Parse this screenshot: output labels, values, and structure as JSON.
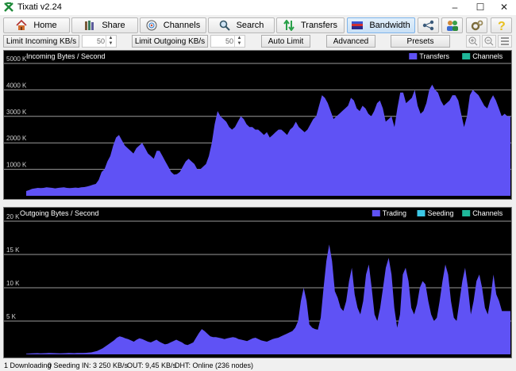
{
  "window": {
    "title": "Tixati v2.24",
    "controls": [
      "–",
      "☐",
      "✕"
    ]
  },
  "toolbar": {
    "buttons": [
      {
        "label": "Home",
        "icon": "home-icon"
      },
      {
        "label": "Share",
        "icon": "share-icon"
      },
      {
        "label": "Channels",
        "icon": "channels-icon"
      },
      {
        "label": "Search",
        "icon": "search-icon"
      },
      {
        "label": "Transfers",
        "icon": "transfers-icon"
      },
      {
        "label": "Bandwidth",
        "icon": "bandwidth-icon",
        "active": true
      }
    ],
    "icon_buttons": [
      "network-icon",
      "users-icon",
      "settings-icon",
      "help-icon"
    ]
  },
  "controls": {
    "limit_in_label": "Limit Incoming KB/s",
    "limit_in_value": "50",
    "limit_out_label": "Limit Outgoing KB/s",
    "limit_out_value": "50",
    "auto_limit_label": "Auto Limit",
    "advanced_label": "Advanced",
    "presets_label": "Presets"
  },
  "colors": {
    "transfers": "#5f52f5",
    "trading": "#5f52f5",
    "seeding": "#3cc8e6",
    "channels": "#1fb89a",
    "gridline": "#9a9a9a"
  },
  "chart_data": [
    {
      "type": "area",
      "title": "Incoming Bytes / Second",
      "ylim": [
        0,
        5000
      ],
      "y_ticks": [
        "1000 K",
        "2000 K",
        "3000 K",
        "4000 K",
        "5000 K"
      ],
      "grid": true,
      "legend": [
        {
          "name": "Transfers"
        },
        {
          "name": "Channels"
        }
      ],
      "series": [
        {
          "name": "Transfers",
          "values": [
            180,
            220,
            260,
            280,
            300,
            290,
            300,
            320,
            310,
            300,
            280,
            300,
            310,
            320,
            300,
            290,
            300,
            310,
            300,
            320,
            330,
            350,
            380,
            420,
            450,
            600,
            900,
            1000,
            1300,
            1500,
            1900,
            2200,
            2300,
            2100,
            1900,
            1800,
            1700,
            1600,
            1800,
            1900,
            2000,
            1800,
            1600,
            1500,
            1400,
            1700,
            1700,
            1500,
            1300,
            1100,
            900,
            800,
            820,
            900,
            1100,
            1300,
            1400,
            1300,
            1200,
            1000,
            1000,
            1100,
            1200,
            1500,
            2000,
            2700,
            3200,
            3000,
            2900,
            2800,
            2600,
            2500,
            2600,
            2800,
            3000,
            2900,
            2700,
            2600,
            2600,
            2500,
            2500,
            2400,
            2300,
            2400,
            2200,
            2300,
            2400,
            2500,
            2500,
            2400,
            2300,
            2500,
            2600,
            2800,
            2600,
            2500,
            2400,
            2500,
            2700,
            2900,
            3000,
            3400,
            3800,
            3700,
            3500,
            3200,
            2900,
            3000,
            3100,
            3200,
            3300,
            3400,
            3700,
            3600,
            3300,
            3200,
            3400,
            3300,
            3100,
            3000,
            3200,
            3500,
            3600,
            3300,
            2800,
            2900,
            3000,
            2600,
            3300,
            3900,
            3900,
            3500,
            3600,
            3700,
            4000,
            3400,
            3100,
            3200,
            3500,
            4000,
            4200,
            4000,
            3900,
            3600,
            3400,
            3500,
            3600,
            3800,
            3800,
            3600,
            3100,
            2600,
            3000,
            3800,
            4000,
            3900,
            3800,
            3600,
            3400,
            3300,
            3600,
            3800,
            3600,
            3300,
            3000,
            3100,
            3000,
            3000
          ]
        },
        {
          "name": "Channels",
          "values": []
        }
      ]
    },
    {
      "type": "area",
      "title": "Outgoing Bytes / Second",
      "ylim": [
        0,
        20000
      ],
      "y_ticks": [
        "5 K",
        "10 K",
        "15 K",
        "20 K"
      ],
      "grid": true,
      "legend": [
        {
          "name": "Trading"
        },
        {
          "name": "Seeding"
        },
        {
          "name": "Channels"
        }
      ],
      "series": [
        {
          "name": "Trading",
          "values": [
            100,
            120,
            150,
            170,
            180,
            160,
            170,
            180,
            200,
            190,
            180,
            170,
            160,
            170,
            180,
            200,
            190,
            180,
            200,
            210,
            220,
            230,
            260,
            300,
            400,
            500,
            700,
            900,
            1200,
            1500,
            1800,
            2100,
            2500,
            2700,
            2600,
            2400,
            2300,
            2100,
            1900,
            2200,
            2400,
            2300,
            2100,
            1900,
            1800,
            2000,
            2200,
            1900,
            1700,
            1500,
            1600,
            1800,
            2000,
            2200,
            2000,
            1800,
            1500,
            1400,
            1600,
            1800,
            2500,
            3200,
            3800,
            3500,
            3100,
            2700,
            2600,
            2600,
            2500,
            2400,
            2300,
            2400,
            2500,
            2600,
            2500,
            2300,
            2200,
            2100,
            2000,
            2200,
            2400,
            2500,
            2300,
            2100,
            2000,
            1900,
            2100,
            2300,
            2400,
            2500,
            2700,
            2900,
            3100,
            3300,
            3500,
            4000,
            5000,
            8000,
            10000,
            8000,
            4500,
            4000,
            3800,
            3700,
            5500,
            10000,
            14000,
            16500,
            14000,
            9500,
            8500,
            7000,
            6500,
            8000,
            11000,
            13000,
            9000,
            7000,
            6000,
            8000,
            12000,
            13500,
            10000,
            6000,
            5000,
            7000,
            10000,
            13000,
            14500,
            12000,
            7000,
            4000,
            6000,
            12000,
            13000,
            11000,
            7000,
            6000,
            7500,
            10000,
            11000,
            10500,
            8000,
            6000,
            5000,
            5500,
            8000,
            11000,
            13500,
            12000,
            8000,
            5500,
            5000,
            8000,
            11000,
            13000,
            10000,
            6000,
            8000,
            11000,
            12000,
            10000,
            7000,
            6000,
            8500,
            12000,
            9000,
            8000,
            6500,
            6500,
            6500,
            6500
          ]
        },
        {
          "name": "Seeding",
          "values": []
        },
        {
          "name": "Channels",
          "values": []
        }
      ]
    }
  ],
  "status": {
    "downloading": "1 Downloading",
    "seeding": "0 Seeding",
    "in": "IN: 3 250 KB/s",
    "out": "OUT: 9,45 KB/s",
    "dht": "DHT: Online (236 nodes)"
  }
}
